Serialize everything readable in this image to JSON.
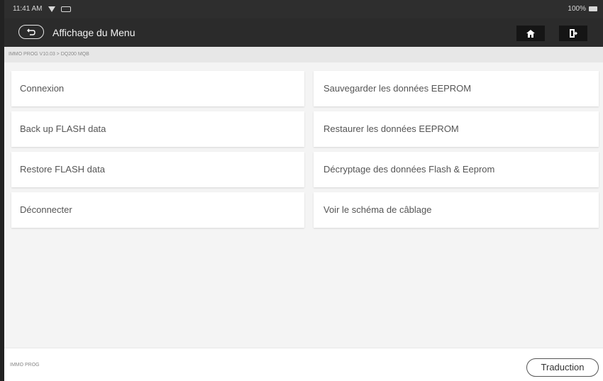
{
  "status_bar": {
    "time": "11:41 AM",
    "battery_text": "100%"
  },
  "app_bar": {
    "title": "Affichage du Menu"
  },
  "breadcrumb": {
    "path": "IMMO PROG V10.03 > DQ200 MQB"
  },
  "menu": {
    "left": [
      "Connexion",
      "Back up FLASH data",
      "Restore FLASH data",
      "Déconnecter"
    ],
    "right": [
      "Sauvegarder les données EEPROM",
      "Restaurer les données EEPROM",
      "Décryptage des données Flash & Eeprom",
      "Voir le schéma de câblage"
    ]
  },
  "footer": {
    "left_label": "IMMO PROG",
    "translate_button": "Traduction"
  },
  "icons": {
    "back": "back-arrow-icon",
    "home": "home-icon",
    "exit": "exit-icon",
    "wifi": "wifi-icon",
    "sim": "sim-icon",
    "battery": "battery-icon"
  }
}
